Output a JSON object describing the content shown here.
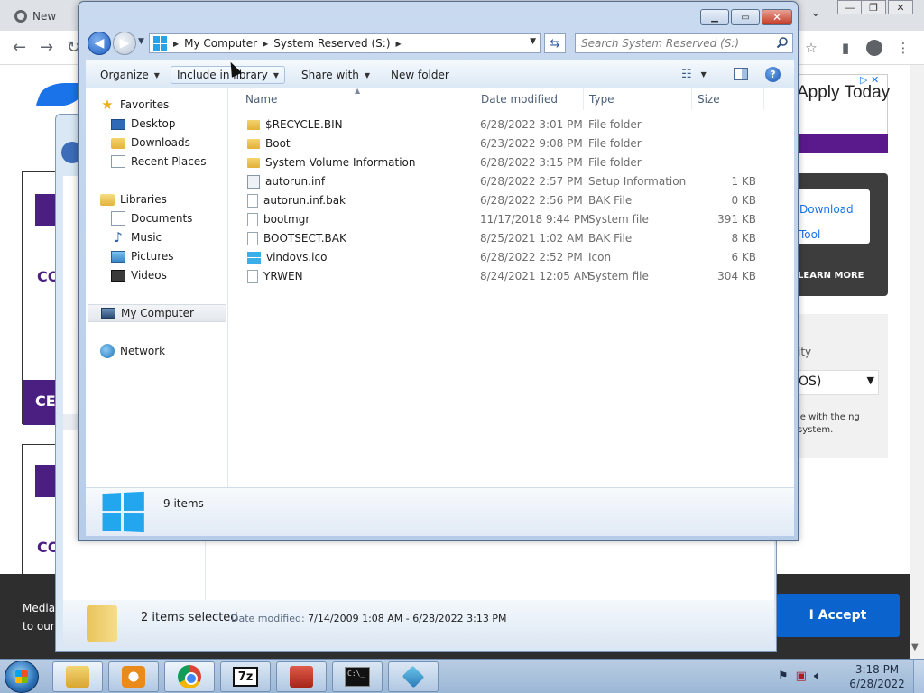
{
  "browser": {
    "tab_label": "New",
    "ad_text": "Apply Today",
    "download_link": "Download Tool",
    "learn_more": "LEARN MORE",
    "os_label": "ity",
    "os_select": "OS)",
    "os_note": "le with the ng system.",
    "card_text_co": "CO",
    "card_text_ce": "CE",
    "cookie_text": "Media to our",
    "accept_label": "I Accept"
  },
  "explorer": {
    "breadcrumbs": [
      "My Computer",
      "System Reserved (S:)"
    ],
    "search_placeholder": "Search System Reserved (S:)",
    "toolbar": {
      "organize": "Organize",
      "include_in_library": "Include in library",
      "share_with": "Share with",
      "new_folder": "New folder"
    },
    "nav": {
      "favorites": "Favorites",
      "desktop": "Desktop",
      "downloads": "Downloads",
      "recent_places": "Recent Places",
      "libraries": "Libraries",
      "documents": "Documents",
      "music": "Music",
      "pictures": "Pictures",
      "videos": "Videos",
      "my_computer": "My Computer",
      "network": "Network"
    },
    "columns": {
      "name": "Name",
      "date_modified": "Date modified",
      "type": "Type",
      "size": "Size"
    },
    "files": [
      {
        "name": "$RECYCLE.BIN",
        "date": "6/28/2022 3:01 PM",
        "type": "File folder",
        "size": "",
        "icon": "folder-icon"
      },
      {
        "name": "Boot",
        "date": "6/23/2022 9:08 PM",
        "type": "File folder",
        "size": "",
        "icon": "folder-icon"
      },
      {
        "name": "System Volume Information",
        "date": "6/28/2022 3:15 PM",
        "type": "File folder",
        "size": "",
        "icon": "folder-icon"
      },
      {
        "name": "autorun.inf",
        "date": "6/28/2022 2:57 PM",
        "type": "Setup Information",
        "size": "1 KB",
        "icon": "setup-file-icon"
      },
      {
        "name": "autorun.inf.bak",
        "date": "6/28/2022 2:56 PM",
        "type": "BAK File",
        "size": "0 KB",
        "icon": "file-icon"
      },
      {
        "name": "bootmgr",
        "date": "11/17/2018 9:44 PM",
        "type": "System file",
        "size": "391 KB",
        "icon": "system-file-icon"
      },
      {
        "name": "BOOTSECT.BAK",
        "date": "8/25/2021 1:02 AM",
        "type": "BAK File",
        "size": "8 KB",
        "icon": "file-icon"
      },
      {
        "name": "vindovs.ico",
        "date": "6/28/2022 2:52 PM",
        "type": "Icon",
        "size": "6 KB",
        "icon": "windows-icon-file"
      },
      {
        "name": "YRWEN",
        "date": "8/24/2021 12:05 AM",
        "type": "System file",
        "size": "304 KB",
        "icon": "system-file-icon"
      }
    ],
    "item_count": "9 items"
  },
  "explorer_behind": {
    "selected_count": "2 items selected",
    "date_modified_label": "Date modified:",
    "date_modified_value": "7/14/2009 1:08 AM - 6/28/2022 3:13 PM"
  },
  "taskbar": {
    "time": "3:18 PM",
    "date": "6/28/2022",
    "sevenzip_label": "7z"
  }
}
